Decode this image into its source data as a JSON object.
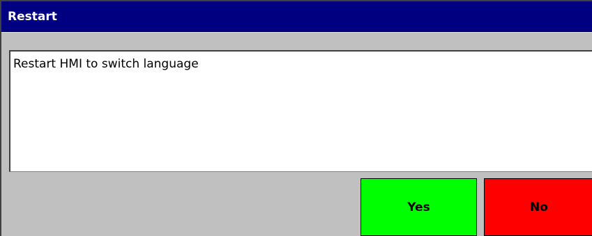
{
  "dialog": {
    "title": "Restart",
    "message": "Restart HMI to switch language"
  },
  "buttons": {
    "yes_label": "Yes",
    "no_label": "No"
  },
  "colors": {
    "titlebar": "#000080",
    "yes_button": "#00ff00",
    "no_button": "#ff0000",
    "dialog_background": "#c0c0c0"
  }
}
